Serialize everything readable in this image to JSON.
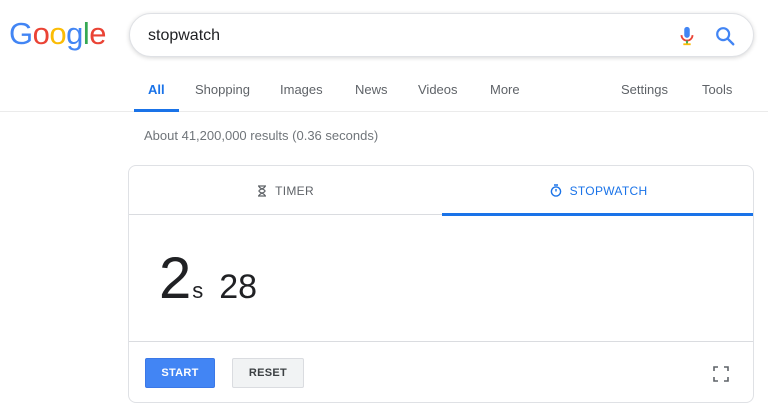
{
  "logo": {
    "letters": [
      "G",
      "o",
      "o",
      "g",
      "l",
      "e"
    ],
    "colors": [
      "#4285f4",
      "#ea4335",
      "#fbbc05",
      "#4285f4",
      "#34a853",
      "#ea4335"
    ]
  },
  "search": {
    "query": "stopwatch"
  },
  "nav": {
    "tabs": [
      "All",
      "Shopping",
      "Images",
      "News",
      "Videos",
      "More"
    ],
    "settings": "Settings",
    "tools": "Tools"
  },
  "results": {
    "stats": "About 41,200,000 results (0.36 seconds)"
  },
  "widget": {
    "tabs": {
      "timer": "TIMER",
      "stopwatch": "STOPWATCH"
    },
    "time": {
      "seconds": "2",
      "unit": "s",
      "centiseconds": "28"
    },
    "buttons": {
      "start": "START",
      "reset": "RESET"
    }
  },
  "colors": {
    "accent": "#1a73e8",
    "start_button": "#4285f4"
  }
}
